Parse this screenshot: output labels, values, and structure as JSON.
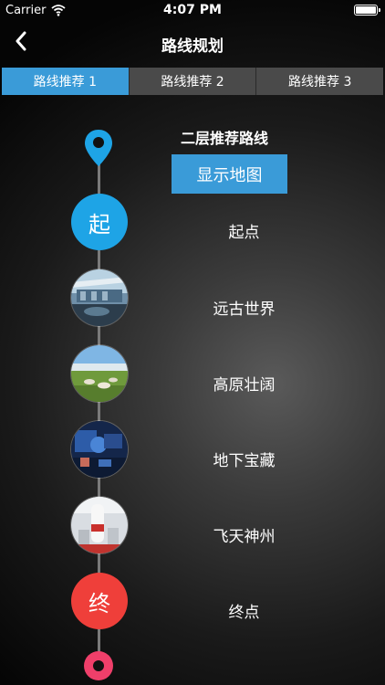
{
  "status_bar": {
    "carrier": "Carrier",
    "time": "4:07 PM"
  },
  "nav": {
    "title": "路线规划",
    "back_icon": "chevron-left-icon"
  },
  "tabs": [
    {
      "label": "路线推荐 1",
      "active": true
    },
    {
      "label": "路线推荐 2",
      "active": false
    },
    {
      "label": "路线推荐 3",
      "active": false
    }
  ],
  "route": {
    "title": "二层推荐路线",
    "map_button_label": "显示地图",
    "stops": [
      {
        "label": "起点",
        "marker_text": "起",
        "kind": "start"
      },
      {
        "label": "远古世界",
        "kind": "photo"
      },
      {
        "label": "高原壮阔",
        "kind": "photo"
      },
      {
        "label": "地下宝藏",
        "kind": "photo"
      },
      {
        "label": "飞天神州",
        "kind": "photo"
      },
      {
        "label": "终点",
        "marker_text": "终",
        "kind": "end"
      }
    ]
  },
  "colors": {
    "accent": "#3a9bd8",
    "start": "#1ea4e6",
    "end": "#ef3f3a",
    "end_marker": "#ef3f6a"
  }
}
